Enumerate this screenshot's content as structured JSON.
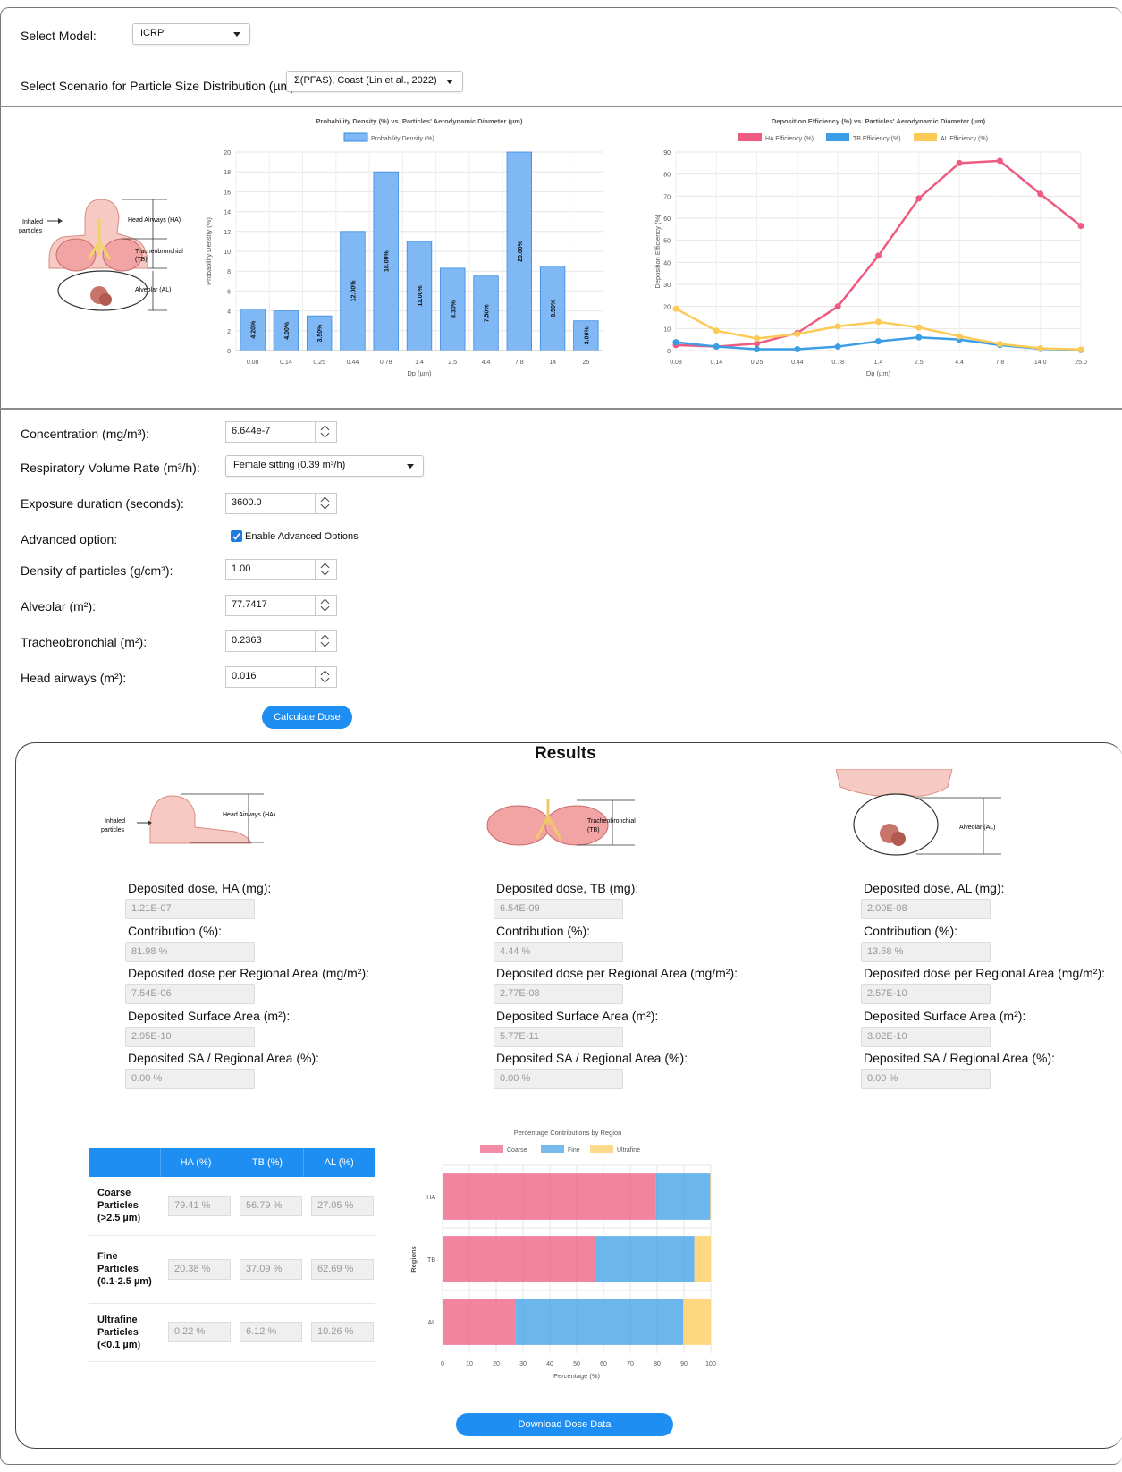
{
  "header": {
    "select_model_label": "Select Model:",
    "model_value": "ICRP",
    "scenario_label": "Select Scenario for Particle Size Distribution (µm):",
    "scenario_value": "Σ(PFAS), Coast (Lin et al., 2022)"
  },
  "diagram": {
    "inhaled": "Inhaled",
    "particles": "particles",
    "ha": "Head Airways (HA)",
    "tb1": "Tracheobronchial",
    "tb2": "(TB)",
    "al": "Alveolar (AL)"
  },
  "inputs": {
    "concentration_label": "Concentration (mg/m³):",
    "concentration_value": "6.644e-7",
    "resp_label": "Respiratory Volume Rate (m³/h):",
    "resp_value": "Female sitting (0.39 m³/h)",
    "exposure_label": "Exposure duration (seconds):",
    "exposure_value": "3600.0",
    "advanced_label": "Advanced option:",
    "advanced_checkbox_label": "Enable Advanced Options",
    "density_label": "Density of particles (g/cm³):",
    "density_value": "1.00",
    "alveolar_label": "Alveolar (m²):",
    "alveolar_value": "77.7417",
    "tracheo_label": "Tracheobronchial (m²):",
    "tracheo_value": "0.2363",
    "head_label": "Head airways (m²):",
    "head_value": "0.016",
    "calculate_button": "Calculate Dose"
  },
  "results": {
    "title": "Results",
    "columns": [
      {
        "dose_label": "Deposited dose, HA (mg):",
        "dose": "1.21E-07",
        "contrib_label": "Contribution (%):",
        "contrib": "81.98 %",
        "area_label": "Deposited dose per Regional Area (mg/m²):",
        "area": "7.54E-06",
        "sa_label": "Deposited Surface Area (m²):",
        "sa": "2.95E-10",
        "sar_label": "Deposited SA / Regional Area (%):",
        "sar": "0.00 %"
      },
      {
        "dose_label": "Deposited dose, TB (mg):",
        "dose": "6.54E-09",
        "contrib_label": "Contribution (%):",
        "contrib": "4.44 %",
        "area_label": "Deposited dose per Regional Area (mg/m²):",
        "area": "2.77E-08",
        "sa_label": "Deposited Surface Area (m²):",
        "sa": "5.77E-11",
        "sar_label": "Deposited SA / Regional Area (%):",
        "sar": "0.00 %"
      },
      {
        "dose_label": "Deposited dose, AL (mg):",
        "dose": "2.00E-08",
        "contrib_label": "Contribution (%):",
        "contrib": "13.58 %",
        "area_label": "Deposited dose per Regional Area (mg/m²):",
        "area": "2.57E-10",
        "sa_label": "Deposited Surface Area (m²):",
        "sa": "3.02E-10",
        "sar_label": "Deposited SA / Regional Area (%):",
        "sar": "0.00 %"
      }
    ],
    "table": {
      "headers": [
        "HA (%)",
        "TB (%)",
        "AL (%)"
      ],
      "rows": [
        {
          "label": "Coarse Particles (>2.5 µm)",
          "values": [
            "79.41 %",
            "56.79 %",
            "27.05 %"
          ]
        },
        {
          "label": "Fine Particles (0.1-2.5 µm)",
          "values": [
            "20.38 %",
            "37.09 %",
            "62.69 %"
          ]
        },
        {
          "label": "Ultrafine Particles (<0.1 µm)",
          "values": [
            "0.22 %",
            "6.12 %",
            "10.26 %"
          ]
        }
      ]
    },
    "download_button": "Download Dose Data"
  },
  "colors": {
    "accent": "#1e8ef2",
    "bar_fill": "#7fb8f5",
    "ha": "#ee5b80",
    "tb": "#3a9ee6",
    "al": "#fccb57"
  },
  "chart_data": [
    {
      "type": "bar",
      "title": "Probability Density (%) vs. Particles' Aerodynamic Diameter (µm)",
      "legend": [
        "Probability Density (%)"
      ],
      "xlabel": "Dp (µm)",
      "ylabel": "Probability Density (%)",
      "categories": [
        "0.08",
        "0.14",
        "0.25",
        "0.44",
        "0.78",
        "1.4",
        "2.5",
        "4.4",
        "7.8",
        "14",
        "25"
      ],
      "values": [
        4.2,
        4.0,
        3.5,
        12.0,
        18.0,
        11.0,
        8.3,
        7.5,
        20.0,
        8.5,
        3.0
      ],
      "data_labels": [
        "4.20%",
        "4.00%",
        "3.50%",
        "12.00%",
        "18.00%",
        "11.00%",
        "8.30%",
        "7.50%",
        "20.00%",
        "8.50%",
        "3.00%"
      ],
      "yticks": [
        "0",
        "2",
        "4",
        "6",
        "8",
        "10",
        "12",
        "14",
        "16",
        "18",
        "20"
      ],
      "ylim": [
        0,
        20
      ]
    },
    {
      "type": "line",
      "title": "Deposition Efficiency (%) vs. Particles' Aerodynamic Diameter (µm)",
      "xlabel": "Dp (µm)",
      "ylabel": "Deposition Efficiency (%)",
      "categories": [
        "0.08",
        "0.14",
        "0.25",
        "0.44",
        "0.78",
        "1.4",
        "2.5",
        "4.4",
        "7.8",
        "14.0",
        "25.0"
      ],
      "yticks": [
        "0",
        "10",
        "20",
        "30",
        "40",
        "50",
        "60",
        "70",
        "80",
        "90"
      ],
      "ylim": [
        0,
        90
      ],
      "series": [
        {
          "name": "HA Efficiency (%)",
          "values": [
            2.5,
            1.8,
            3.2,
            8.0,
            20.0,
            43.0,
            69.0,
            85.0,
            86.0,
            71.0,
            56.5
          ]
        },
        {
          "name": "TB Efficiency (%)",
          "values": [
            3.8,
            1.8,
            0.6,
            0.6,
            1.8,
            4.2,
            6.0,
            5.0,
            2.5,
            0.8,
            0.3
          ]
        },
        {
          "name": "AL Efficiency (%)",
          "values": [
            19.0,
            9.0,
            5.5,
            7.5,
            11.0,
            13.0,
            10.5,
            6.5,
            3.0,
            1.0,
            0.5
          ]
        }
      ]
    },
    {
      "type": "bar",
      "orientation": "horizontal",
      "stacked": true,
      "title": "Percentage Contributions by Region",
      "xlabel": "Percentage (%)",
      "ylabel": "Regions",
      "categories": [
        "HA",
        "TB",
        "AL"
      ],
      "xticks": [
        "0",
        "10",
        "20",
        "30",
        "40",
        "50",
        "60",
        "70",
        "80",
        "90",
        "100"
      ],
      "xlim": [
        0,
        100
      ],
      "series": [
        {
          "name": "Coarse",
          "values": [
            79.41,
            56.79,
            27.05
          ]
        },
        {
          "name": "Fine",
          "values": [
            20.38,
            37.09,
            62.69
          ]
        },
        {
          "name": "Ultrafine",
          "values": [
            0.22,
            6.12,
            10.26
          ]
        }
      ]
    }
  ]
}
